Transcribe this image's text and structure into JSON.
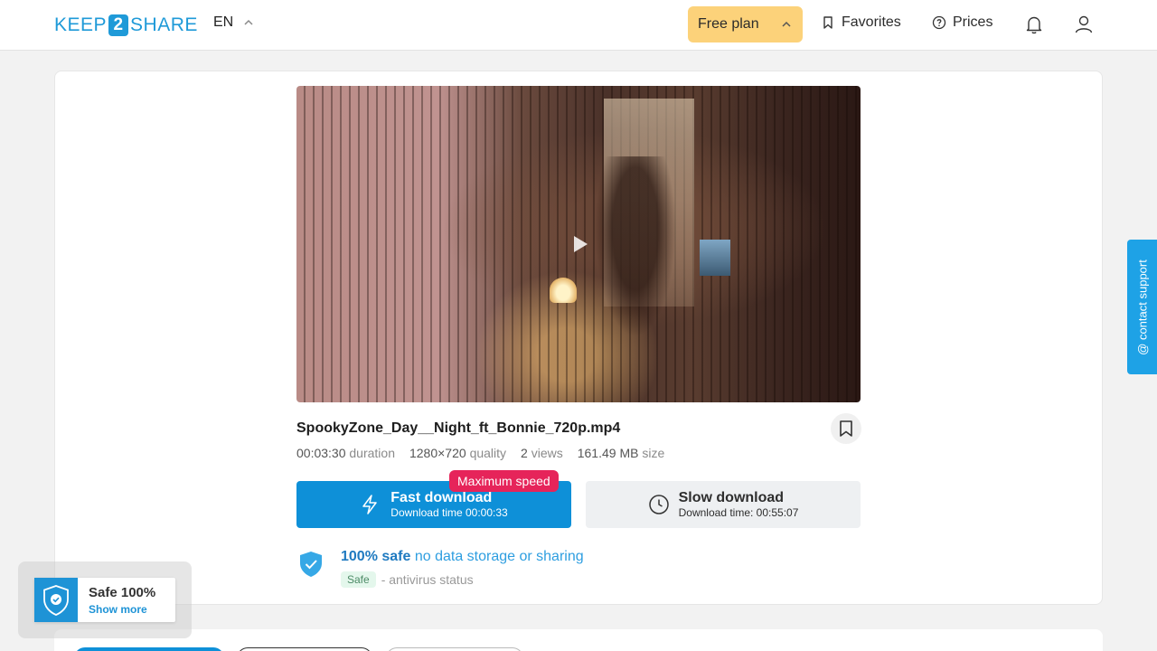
{
  "header": {
    "logo_left": "KEEP",
    "logo_mid": "2",
    "logo_right": "SHARE",
    "language": "EN",
    "plan_label": "Free plan",
    "favorites_label": "Favorites",
    "prices_label": "Prices"
  },
  "file": {
    "name": "SpookyZone_Day__Night_ft_Bonnie_720p.mp4",
    "duration_value": "00:03:30",
    "duration_label": "duration",
    "quality_value": "1280×720",
    "quality_label": "quality",
    "views_value": "2",
    "views_label": "views",
    "size_value": "161.49 MB",
    "size_label": "size"
  },
  "download": {
    "badge": "Maximum speed",
    "fast_title": "Fast download",
    "fast_time": "Download time 00:00:33",
    "slow_title": "Slow download",
    "slow_time": "Download time: 00:55:07"
  },
  "safety": {
    "title_bold": "100% safe",
    "title_rest": "no data storage or sharing",
    "status_pill": "Safe",
    "status_text": "- antivirus status"
  },
  "widget": {
    "title": "Safe 100%",
    "link": "Show more"
  },
  "support": {
    "label": "@ contact support"
  },
  "colors": {
    "accent": "#0e90d8",
    "plan_bg": "#fcd27a",
    "badge": "#e6245a",
    "support": "#1ea2e6"
  }
}
